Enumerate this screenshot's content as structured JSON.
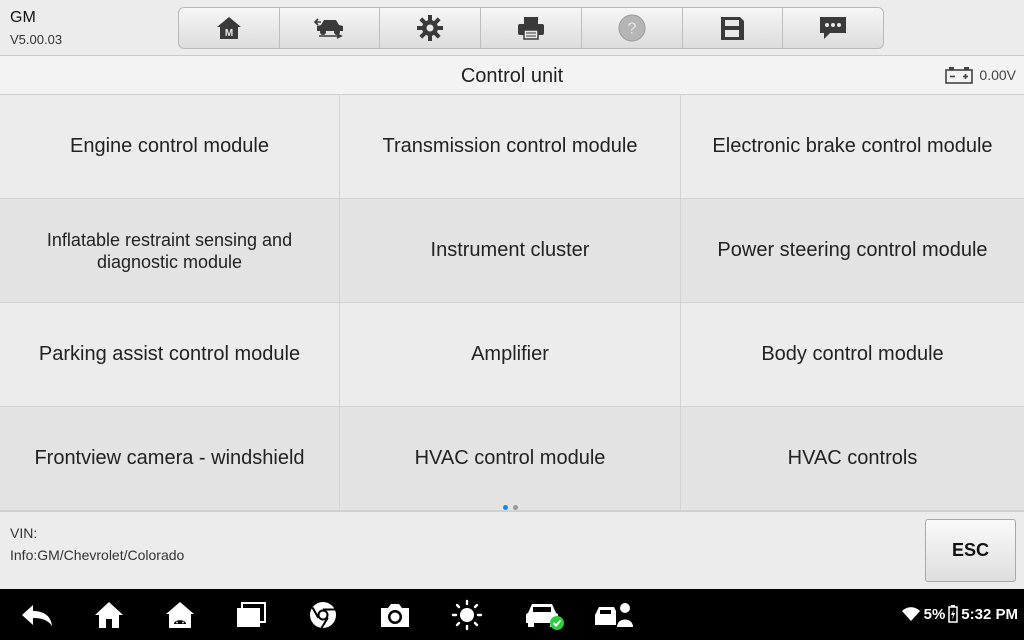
{
  "header": {
    "make": "GM",
    "version": "V5.00.03",
    "tools": [
      {
        "name": "home-icon"
      },
      {
        "name": "vehicle-swap-icon"
      },
      {
        "name": "settings-icon"
      },
      {
        "name": "print-icon"
      },
      {
        "name": "help-icon"
      },
      {
        "name": "save-icon"
      },
      {
        "name": "message-icon"
      }
    ]
  },
  "titlebar": {
    "title": "Control unit",
    "voltage": "0.00V"
  },
  "modules": [
    "Engine control module",
    "Transmission control module",
    "Electronic brake control module",
    "Inflatable restraint sensing and diagnostic module",
    "Instrument cluster",
    "Power steering control module",
    "Parking assist control module",
    "Amplifier",
    "Body control module",
    "Frontview camera - windshield",
    "HVAC control module",
    "HVAC controls"
  ],
  "pager": {
    "current": 1,
    "total": 2
  },
  "footer": {
    "vin_label": "VIN:",
    "info": "Info:GM/Chevrolet/Colorado",
    "esc_label": "ESC"
  },
  "status": {
    "battery": "5%",
    "time": "5:32 PM"
  },
  "colors": {
    "accent": "#1e88e5",
    "cell": "#ececec",
    "cell_alt": "#e3e3e3",
    "navbar": "#000000",
    "check": "#2ecc40"
  }
}
